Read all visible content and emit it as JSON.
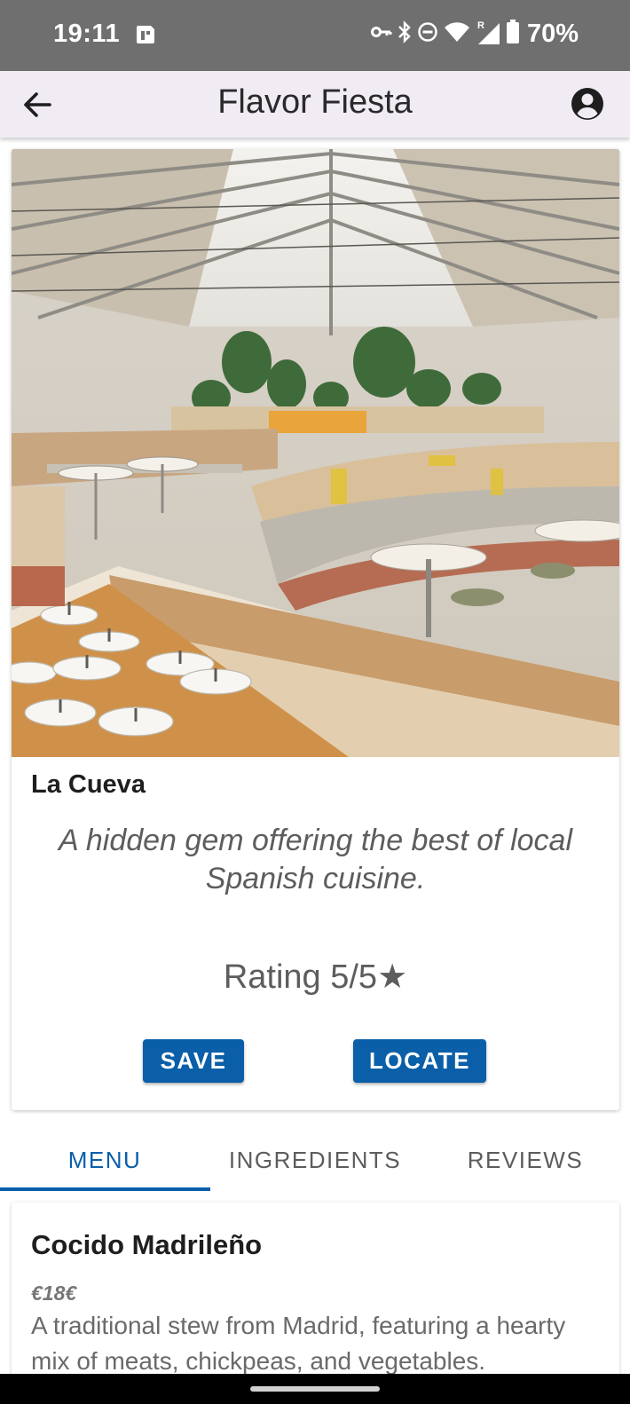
{
  "status_bar": {
    "time": "19:11",
    "battery_percent": "70%",
    "icons": [
      "sim-card-icon",
      "vpn-key-icon",
      "bluetooth-icon",
      "do-not-disturb-icon",
      "wifi-icon",
      "signal-roaming-icon",
      "battery-icon"
    ]
  },
  "app_bar": {
    "title": "Flavor Fiesta",
    "back_icon": "arrow-back-icon",
    "account_icon": "account-circle-icon"
  },
  "restaurant": {
    "name": "La Cueva",
    "description": "A hidden gem offering the best of local Spanish cuisine.",
    "rating_text": "Rating 5/5★",
    "image": "restaurant-interior-photo"
  },
  "actions": {
    "save_label": "SAVE",
    "locate_label": "LOCATE"
  },
  "tabs": [
    {
      "label": "MENU",
      "active": true
    },
    {
      "label": "INGREDIENTS",
      "active": false
    },
    {
      "label": "REVIEWS",
      "active": false
    }
  ],
  "menu_items": [
    {
      "name": "Cocido Madrileño",
      "price": "€18€",
      "description": "A traditional stew from Madrid, featuring a hearty mix of meats, chickpeas, and vegetables."
    }
  ],
  "colors": {
    "primary": "#0a5fa8",
    "status_bar": "#6f6f6f",
    "app_bar": "#f1ebf4"
  }
}
